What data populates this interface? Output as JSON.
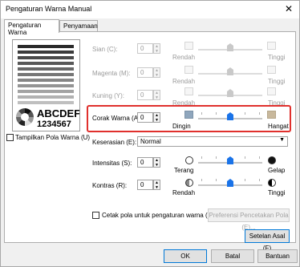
{
  "window": {
    "title": "Pengaturan Warna Manual",
    "close_icon": "close-icon"
  },
  "tabs": [
    {
      "label": "Pengaturan Warna",
      "active": true
    },
    {
      "label": "Penyamaan",
      "active": false
    }
  ],
  "preview": {
    "sample_text_top": "ABCDEF",
    "sample_text_bottom": "1234567",
    "show_pattern_label": "Tampilkan Pola Warna (U)",
    "show_pattern_checked": false
  },
  "color_sliders": [
    {
      "label": "Sian (C):",
      "value": "0",
      "left": "Rendah",
      "right": "Tinggi",
      "enabled": false
    },
    {
      "label": "Magenta (M):",
      "value": "0",
      "left": "Rendah",
      "right": "Tinggi",
      "enabled": false
    },
    {
      "label": "Kuning (Y):",
      "value": "0",
      "left": "Rendah",
      "right": "Tinggi",
      "enabled": false
    },
    {
      "label": "Corak Warna (A):",
      "value": "0",
      "left": "Dingin",
      "right": "Hangat",
      "enabled": true
    }
  ],
  "keserasian": {
    "label": "Keserasian (E):",
    "value": "Normal"
  },
  "intensitas": {
    "label": "Intensitas (S):",
    "value": "0",
    "left": "Terang",
    "right": "Gelap"
  },
  "kontras": {
    "label": "Kontras (R):",
    "value": "0",
    "left": "Rendah",
    "right": "Tinggi"
  },
  "print_pattern": {
    "label": "Cetak pola untuk pengaturan warna (I)",
    "checked": false,
    "prefs_button": "Preferensi Pencetakan Pola (E)..."
  },
  "defaults_button": "Setelan Asal (F)",
  "footer": {
    "ok": "OK",
    "cancel": "Batal",
    "help": "Bantuan"
  },
  "colors": {
    "accent": "#1a73e8",
    "highlight": "#e0302d"
  }
}
